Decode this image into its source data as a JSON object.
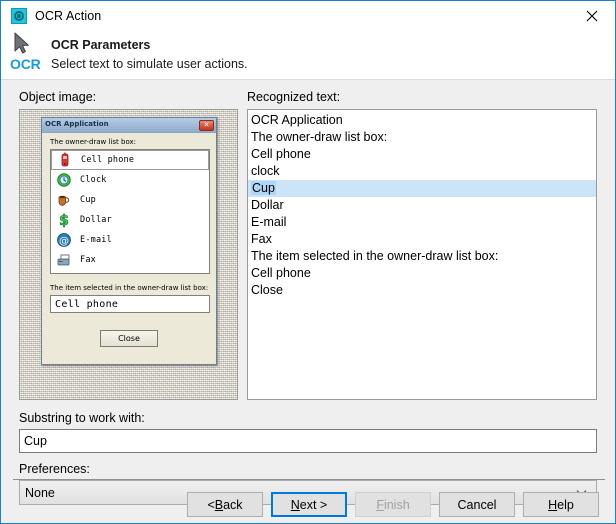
{
  "window": {
    "title": "OCR Action",
    "app_icon": "gear-icon",
    "close_icon": "close-icon",
    "accent_color": "#1981d2",
    "body_color": "#efefef"
  },
  "header": {
    "logo_text": "OCR",
    "logo_icon": "cursor-arrow-icon",
    "title": "OCR Parameters",
    "subtitle": "Select text to simulate user actions.",
    "logo_color": "#1a9ade"
  },
  "object_image": {
    "label": "Object image:",
    "inner_app": {
      "title": "OCR Application",
      "close_glyph": "✕",
      "listbox_label": "The owner-draw list box:",
      "items": [
        {
          "label": "Cell phone",
          "icon": "cell-phone-icon",
          "selected": true
        },
        {
          "label": "Clock",
          "icon": "clock-icon",
          "selected": false
        },
        {
          "label": "Cup",
          "icon": "cup-icon",
          "selected": false
        },
        {
          "label": "Dollar",
          "icon": "dollar-icon",
          "selected": false
        },
        {
          "label": "E-mail",
          "icon": "email-at-icon",
          "selected": false
        },
        {
          "label": "Fax",
          "icon": "fax-icon",
          "selected": false
        }
      ],
      "selected_label": "The item selected in the owner-draw list box:",
      "selected_value": "Cell phone",
      "close_button_label": "Close"
    }
  },
  "recognized_text": {
    "label": "Recognized text:",
    "highlight_color": "#add6f7",
    "lines": [
      {
        "text": "OCR Application",
        "highlighted": false
      },
      {
        "text": "The owner-draw list box:",
        "highlighted": false
      },
      {
        "text": "Cell phone",
        "highlighted": false
      },
      {
        "text": "clock",
        "highlighted": false
      },
      {
        "text": "Cup",
        "highlighted": true
      },
      {
        "text": "Dollar",
        "highlighted": false
      },
      {
        "text": "E-mail",
        "highlighted": false
      },
      {
        "text": "Fax",
        "highlighted": false
      },
      {
        "text": "The item selected in the owner-draw list box:",
        "highlighted": false
      },
      {
        "text": "Cell phone",
        "highlighted": false
      },
      {
        "text": "Close",
        "highlighted": false
      }
    ]
  },
  "substring": {
    "label": "Substring to work with:",
    "value": "Cup",
    "placeholder": ""
  },
  "preferences": {
    "label": "Preferences:",
    "selected": "None",
    "arrow_icon": "chevron-down-icon"
  },
  "buttons": [
    {
      "prefix": "< ",
      "mnemonic": "B",
      "suffix": "ack",
      "state": "enabled",
      "name": "back-button"
    },
    {
      "prefix": "",
      "mnemonic": "N",
      "suffix": "ext >",
      "state": "default",
      "name": "next-button"
    },
    {
      "prefix": "",
      "mnemonic": "F",
      "suffix": "inish",
      "state": "disabled",
      "name": "finish-button"
    },
    {
      "prefix": "",
      "mnemonic": "",
      "suffix": "Cancel",
      "state": "enabled",
      "name": "cancel-button"
    },
    {
      "prefix": "",
      "mnemonic": "H",
      "suffix": "elp",
      "state": "enabled",
      "name": "help-button"
    }
  ]
}
